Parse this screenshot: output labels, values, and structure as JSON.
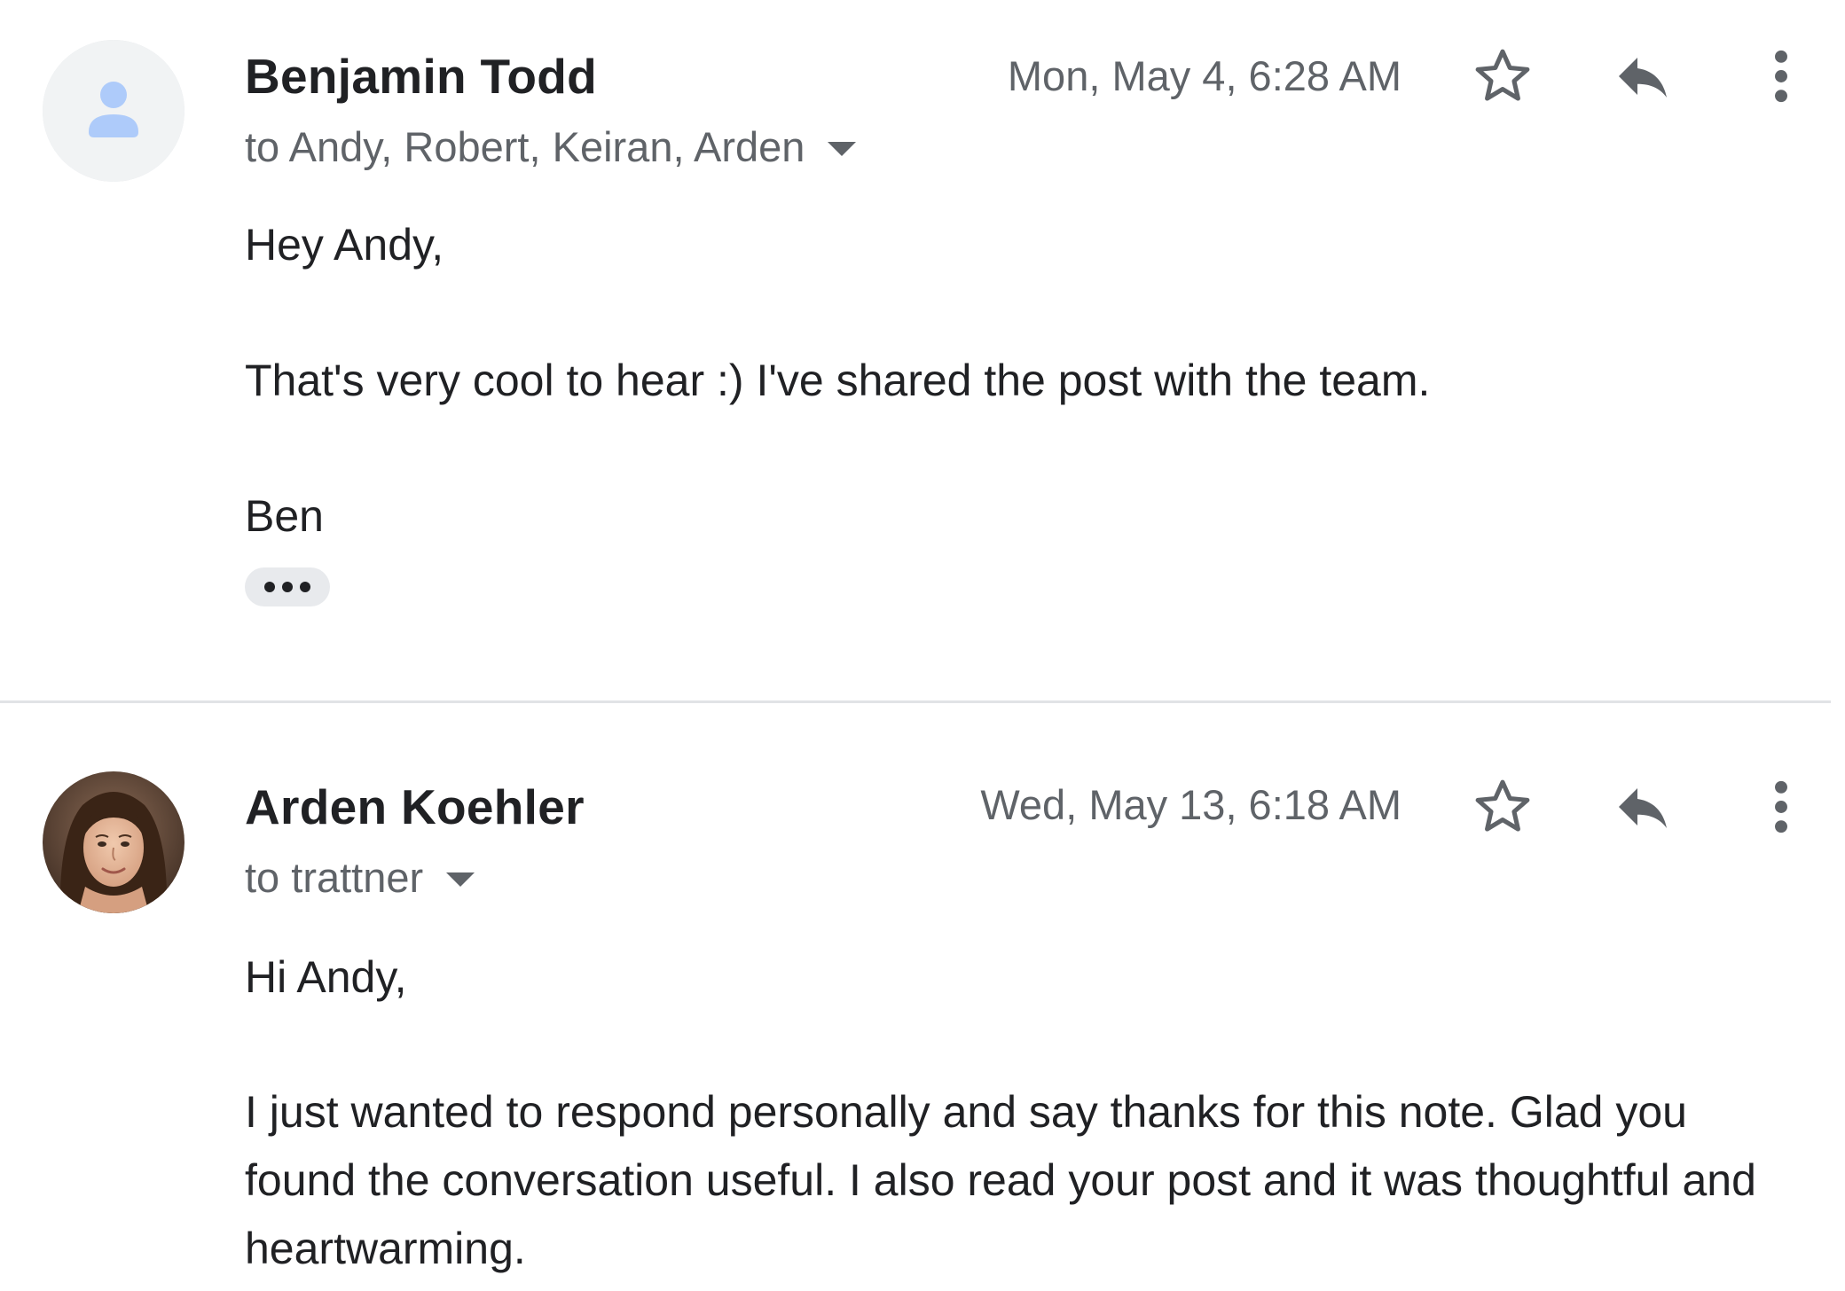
{
  "messages": [
    {
      "sender": "Benjamin Todd",
      "recipients": "to Andy, Robert, Keiran, Arden",
      "timestamp": "Mon, May 4, 6:28 AM",
      "greeting": "Hey Andy,",
      "body": "That's very cool to hear :) I've shared the post with the team.",
      "signature": "Ben",
      "avatar_icon": "default-person-icon",
      "has_trimmed_content": true
    },
    {
      "sender": "Arden Koehler",
      "recipients": "to trattner",
      "timestamp": "Wed, May 13, 6:18 AM",
      "greeting": "Hi Andy,",
      "body": "I just wanted to respond personally and say thanks for this note. Glad you found the conversation useful. I also read your post and it was thoughtful and heartwarming.",
      "avatar_icon": "profile-photo"
    }
  ],
  "icons": {
    "star": "star-outline-icon",
    "reply": "reply-arrow-icon",
    "more": "more-vertical-icon",
    "recipients_toggle": "caret-down-icon"
  },
  "colors": {
    "text_primary": "#202124",
    "text_secondary": "#5f6368",
    "icon": "#5f6368",
    "divider": "#e1e3e6",
    "default_avatar": "#aecbfa"
  }
}
